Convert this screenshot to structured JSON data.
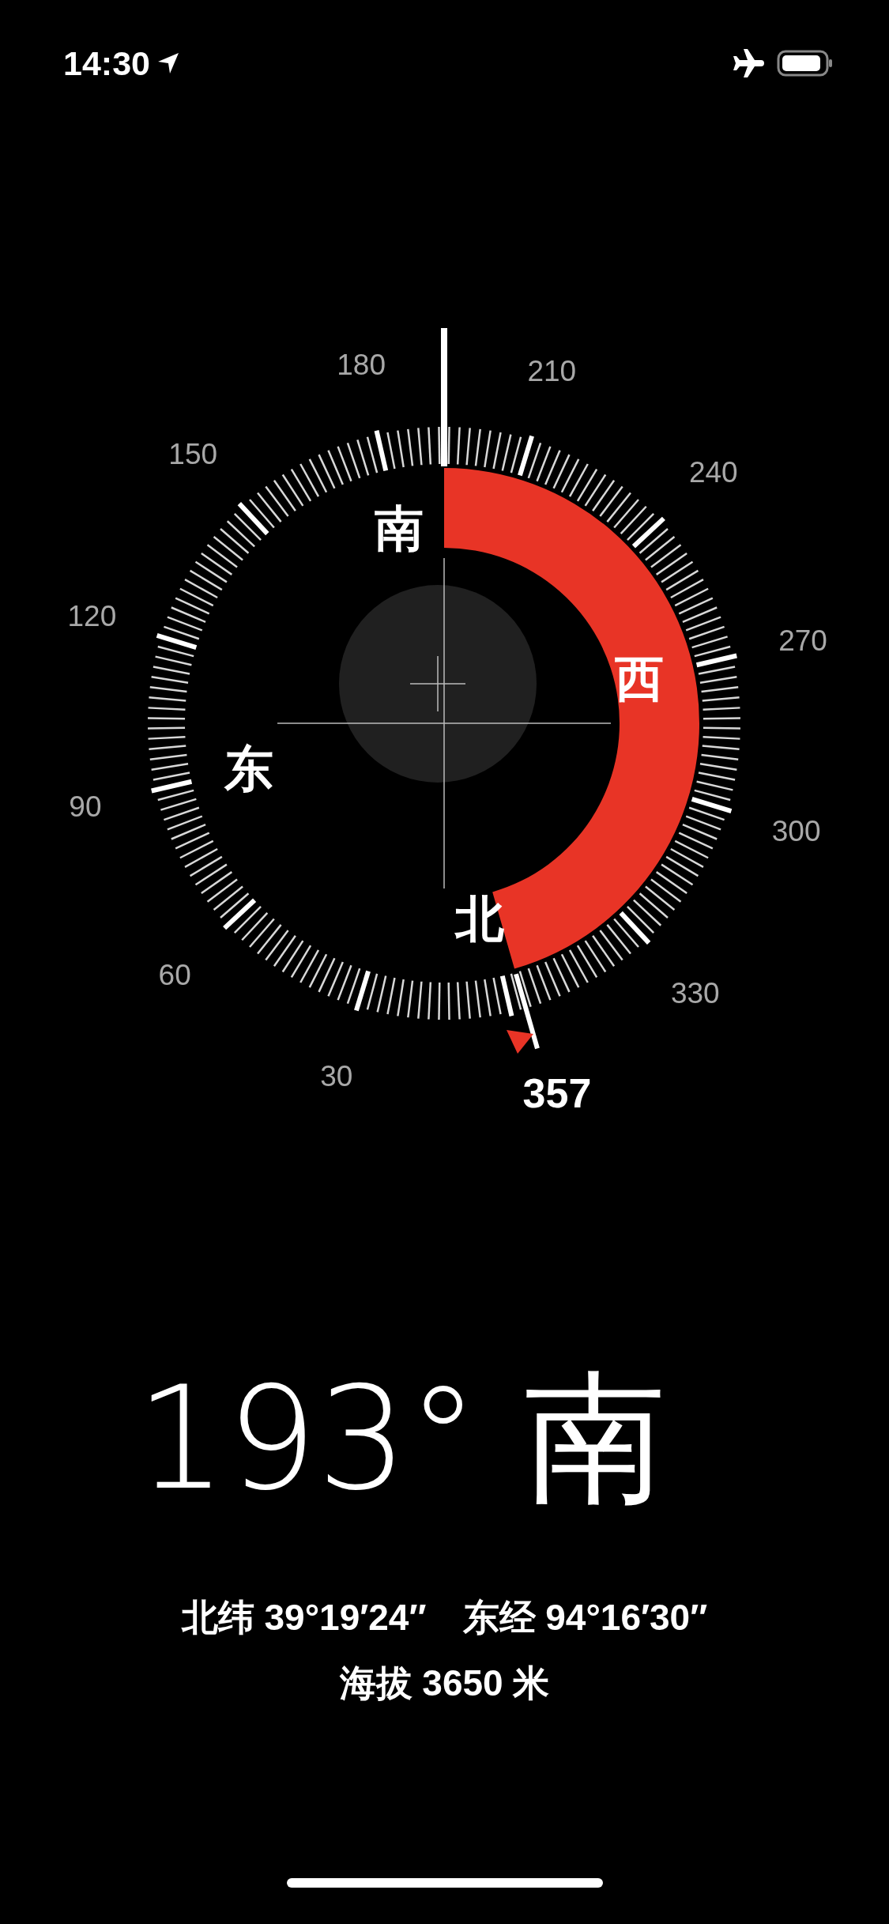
{
  "status_bar": {
    "time": "14:30"
  },
  "compass": {
    "dial_labels": [
      "30",
      "60",
      "90",
      "120",
      "150",
      "180",
      "210",
      "240",
      "270",
      "300",
      "330"
    ],
    "cardinals": [
      "北",
      "东",
      "南",
      "西"
    ],
    "bearing_reading": "357"
  },
  "heading": "193° 南",
  "latitude": "北纬 39°19′24″",
  "longitude": "东经 94°16′30″",
  "altitude": "海拔 3650 米"
}
